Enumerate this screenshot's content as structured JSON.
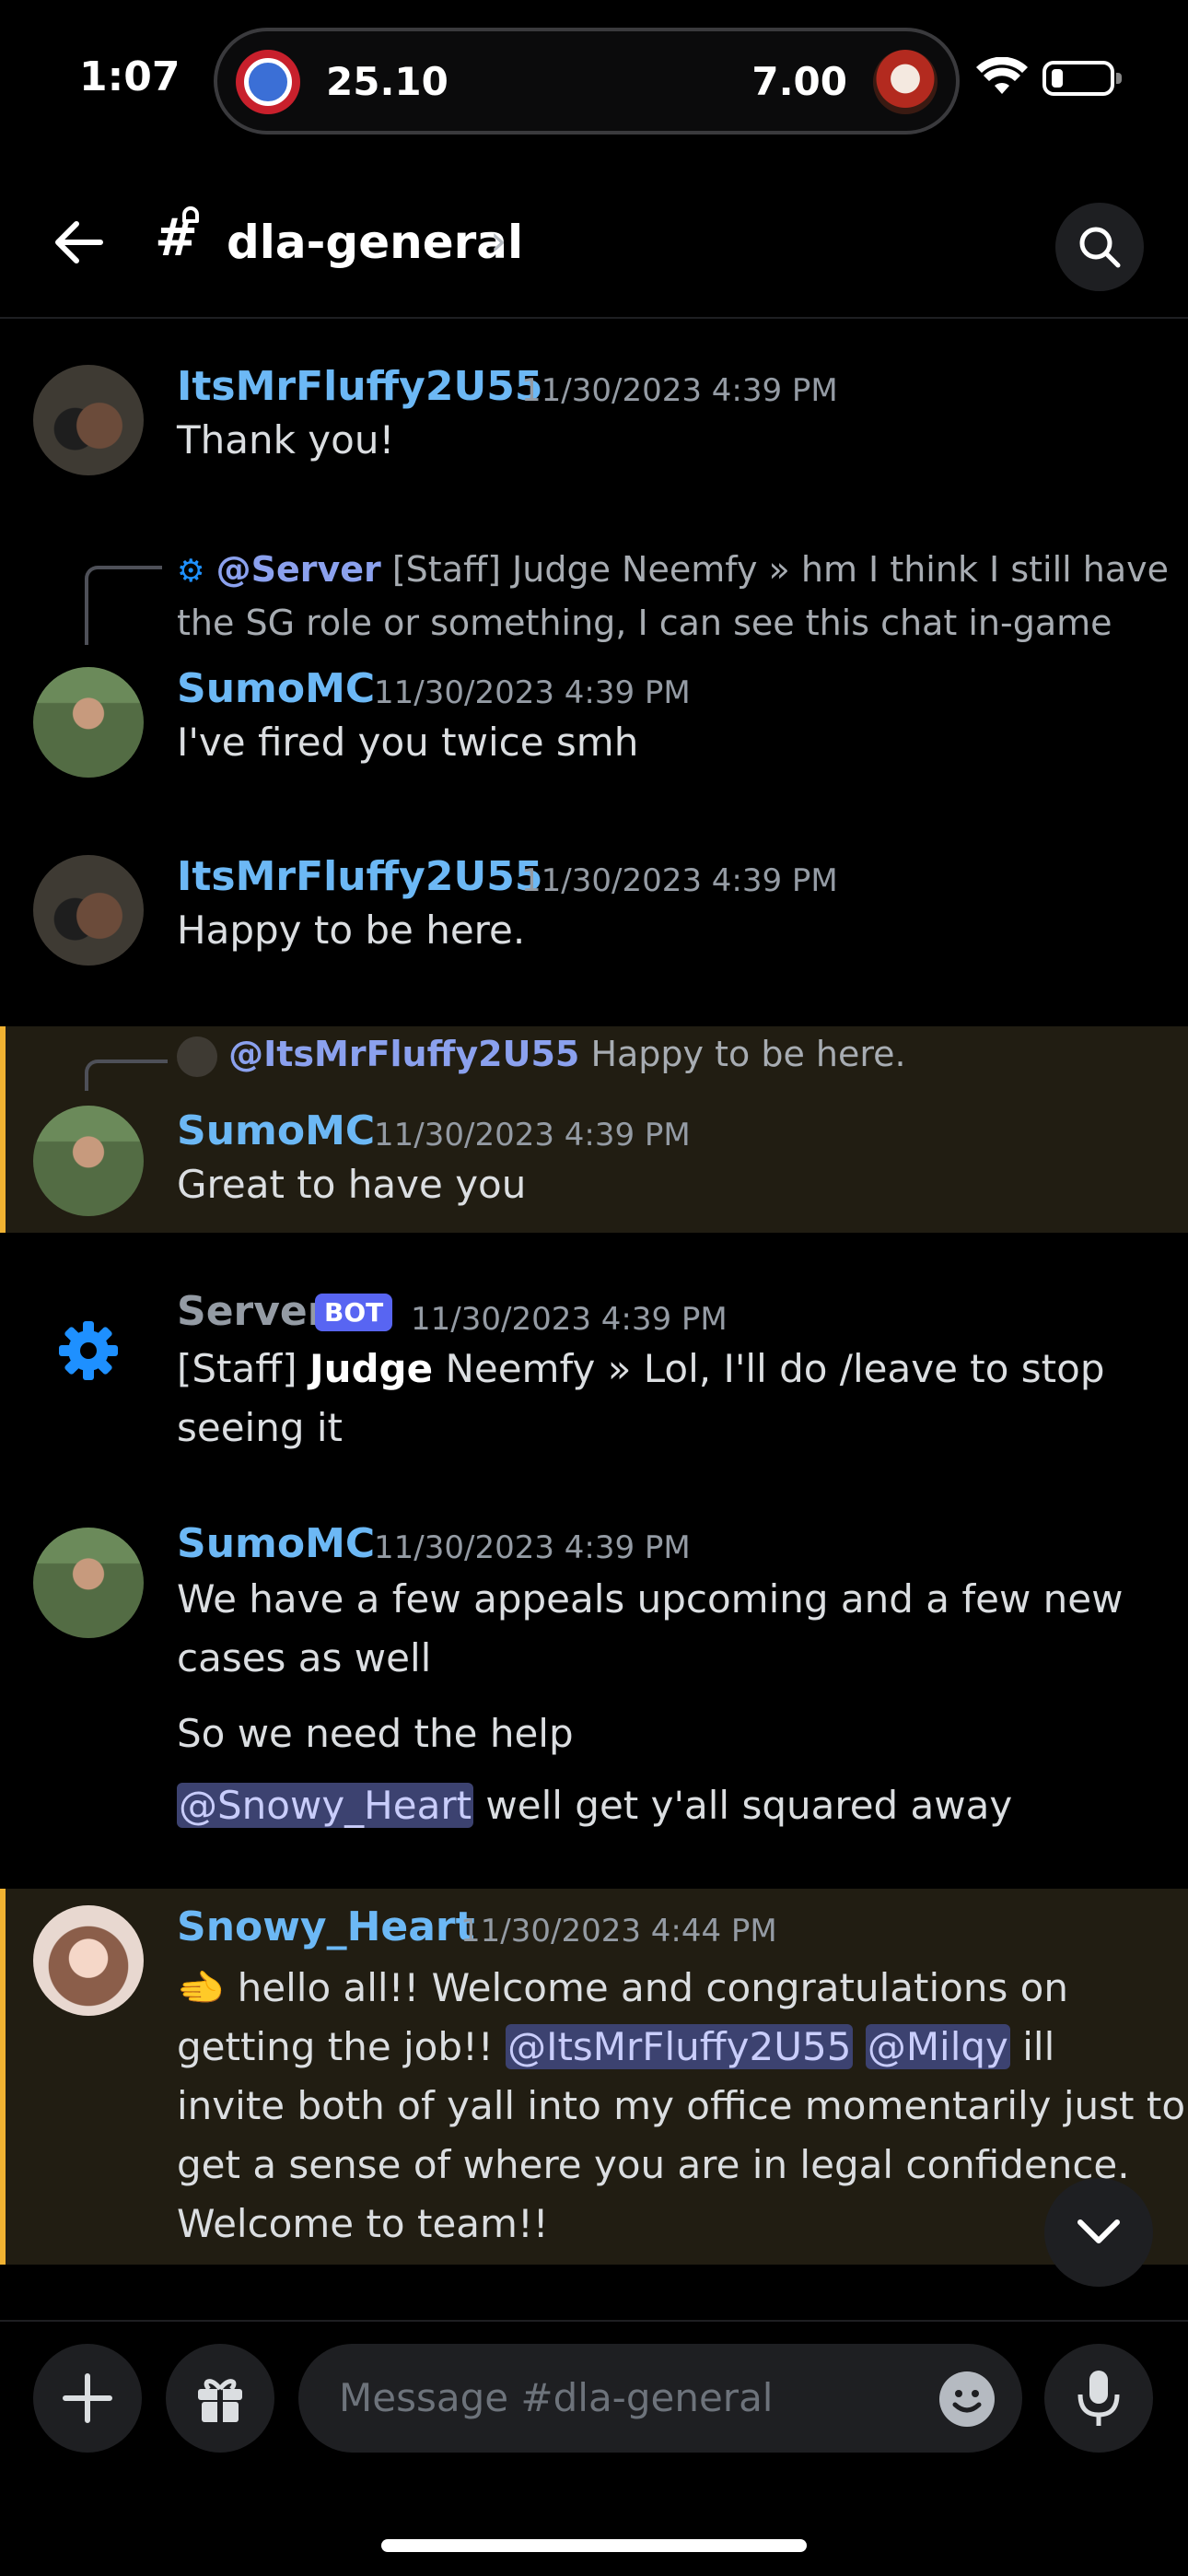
{
  "status_bar": {
    "time": "1:07",
    "live_activity": {
      "left_score": "25.10",
      "right_score": "7.00"
    }
  },
  "header": {
    "channel_name": "dla-general",
    "chevron": "›"
  },
  "messages": [
    {
      "author": "ItsMrFluffy2U55",
      "timestamp": "11/30/2023 4:39 PM",
      "lines": [
        "Thank you!"
      ]
    },
    {
      "reply": {
        "author": "@Server",
        "text_line1": "[Staff] Judge Neemfy » hm I think I still have",
        "text_line2": "the SG role or something, I can see this chat in-game"
      },
      "author": "SumoMC",
      "timestamp": "11/30/2023 4:39 PM",
      "lines": [
        "I've fired you twice smh"
      ]
    },
    {
      "author": "ItsMrFluffy2U55",
      "timestamp": "11/30/2023 4:39 PM",
      "lines": [
        "Happy to be here."
      ]
    },
    {
      "reply": {
        "author": "@ItsMrFluffy2U55",
        "text_line1": "Happy to be here."
      },
      "author": "SumoMC",
      "timestamp": "11/30/2023 4:39 PM",
      "lines": [
        "Great to have you"
      ]
    },
    {
      "author": "Server",
      "badge": "BOT",
      "timestamp": "11/30/2023 4:39 PM",
      "line1_prefix": "[Staff] ",
      "line1_bold": "Judge",
      "line1_suffix": " Neemfy » Lol, I'll do /leave to stop",
      "line2": "seeing it"
    },
    {
      "author": "SumoMC",
      "timestamp": "11/30/2023 4:39 PM",
      "line1": "We have a few appeals upcoming and a few new",
      "line2": "cases as well",
      "line3": "So we need the help",
      "mention": "@Snowy_Heart",
      "line4_suffix": " well get y'all squared away"
    },
    {
      "author": "Snowy_Heart",
      "timestamp": "11/30/2023 4:44 PM",
      "line1": "🫲 hello all!! Welcome and congratulations on",
      "line2_prefix": "getting the job!! ",
      "mention1": "@ItsMrFluffy2U55",
      "mention2": "@Milqy",
      "line2_suffix": "  ill",
      "line3": "invite both of yall into my office momentarily  just to",
      "line4": "get a sense of where you are in legal confidence.",
      "line5": "Welcome to team!!"
    }
  ],
  "composer": {
    "placeholder": "Message #dla-general"
  },
  "colors": {
    "background": "#000000",
    "username": "#6cb8f5",
    "highlight_bg": "#211d12",
    "highlight_border": "#f0b232",
    "bot_badge": "#5865f2"
  }
}
